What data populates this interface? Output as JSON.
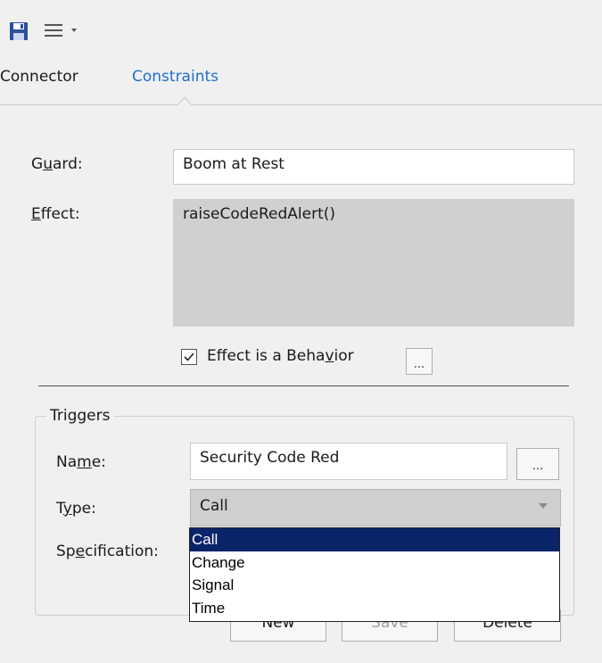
{
  "toolbar": {
    "icons": [
      "save-icon",
      "menu-icon",
      "dropdown-arrow-icon"
    ]
  },
  "tabs": [
    {
      "label": "Connector",
      "active": false
    },
    {
      "label": "Constraints",
      "active": true
    }
  ],
  "guard": {
    "label_pre": "G",
    "label_u": "u",
    "label_post": "ard:",
    "value": "Boom at Rest"
  },
  "effect": {
    "label_u": "E",
    "label_post": "ffect:",
    "value": "raiseCodeRedAlert()",
    "behavior_checkbox_pre": "Effect is a Beha",
    "behavior_checkbox_u": "v",
    "behavior_checkbox_post": "ior",
    "behavior_checked": true,
    "ellipsis": "..."
  },
  "triggers": {
    "title": "Triggers",
    "name_label_pre": "Na",
    "name_label_u": "m",
    "name_label_post": "e:",
    "name_value": "Security Code Red",
    "name_ellipsis": "...",
    "type_label_pre": "T",
    "type_label_u": "y",
    "type_label_post": "pe:",
    "type_value": "Call",
    "spec_label_pre": "Sp",
    "spec_label_u": "e",
    "spec_label_post": "cification:",
    "type_options": [
      "Call",
      "Change",
      "Signal",
      "Time"
    ],
    "selected_option": "Call",
    "buttons": {
      "new": "New",
      "save": "Save",
      "delete": "Delete"
    }
  },
  "colors": {
    "accent_tab": "#1e6fc9",
    "dropdown_selected": "#0a246a"
  }
}
